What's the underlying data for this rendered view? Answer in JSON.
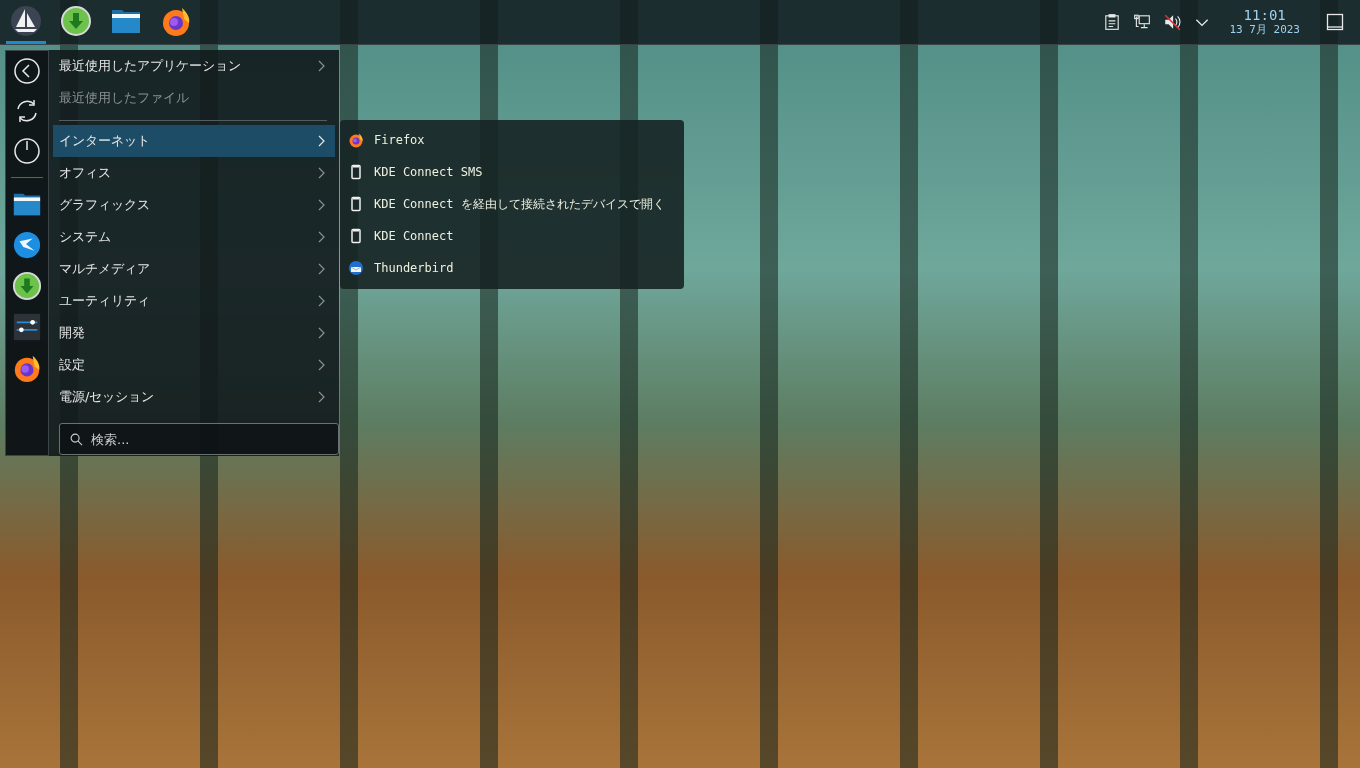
{
  "taskbar": {
    "launchers": [
      {
        "kind": "app-menu",
        "selected": true
      },
      {
        "kind": "download",
        "selected": false
      },
      {
        "kind": "folder",
        "selected": false
      },
      {
        "kind": "firefox",
        "selected": false
      }
    ],
    "tray": {
      "icons": [
        {
          "kind": "clipboard"
        },
        {
          "kind": "network"
        },
        {
          "kind": "volume-muted"
        },
        {
          "kind": "expand"
        }
      ],
      "time": "11:01",
      "date": "13 7月 2023"
    }
  },
  "menu": {
    "sidebar": {
      "actions": [
        {
          "kind": "back"
        },
        {
          "kind": "refresh"
        },
        {
          "kind": "power"
        }
      ],
      "favorites": [
        {
          "kind": "folder"
        },
        {
          "kind": "messenger"
        },
        {
          "kind": "download"
        },
        {
          "kind": "sliders"
        },
        {
          "kind": "firefox"
        }
      ]
    },
    "recent": [
      {
        "label": "最近使用したアプリケーション",
        "disabled": false,
        "selected": false
      },
      {
        "label": "最近使用したファイル",
        "disabled": true,
        "selected": false
      }
    ],
    "categories": [
      {
        "label": "インターネット",
        "selected": true
      },
      {
        "label": "オフィス",
        "selected": false
      },
      {
        "label": "グラフィックス",
        "selected": false
      },
      {
        "label": "システム",
        "selected": false
      },
      {
        "label": "マルチメディア",
        "selected": false
      },
      {
        "label": "ユーティリティ",
        "selected": false
      },
      {
        "label": "開発",
        "selected": false
      },
      {
        "label": "設定",
        "selected": false
      },
      {
        "label": "電源/セッション",
        "selected": false
      }
    ],
    "search": {
      "placeholder": "検索..."
    }
  },
  "submenu": {
    "items": [
      {
        "kind": "firefox",
        "label": "Firefox"
      },
      {
        "kind": "phone",
        "label": "KDE Connect SMS"
      },
      {
        "kind": "phone",
        "label": "KDE Connect を経由して接続されたデバイスで開く"
      },
      {
        "kind": "phone",
        "label": "KDE Connect"
      },
      {
        "kind": "thunderbird",
        "label": "Thunderbird"
      }
    ]
  }
}
